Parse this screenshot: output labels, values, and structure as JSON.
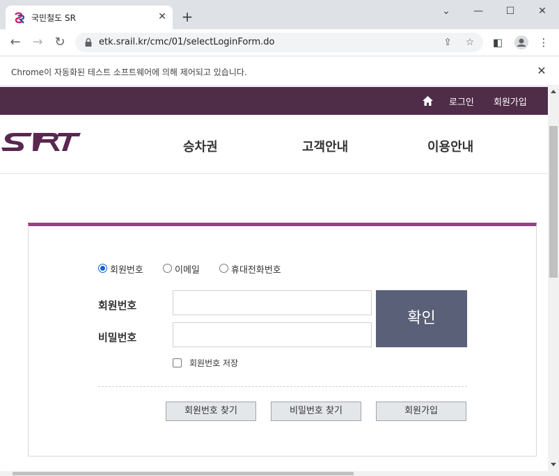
{
  "browser": {
    "tab_title": "국민철도 SR",
    "url": "etk.srail.kr/cmc/01/selectLoginForm.do",
    "infobar_text": "Chrome이 자동화된 테스트 소프트웨어에 의해 제어되고 있습니다.",
    "icons": [
      "back-arrow-icon",
      "forward-arrow-icon",
      "reload-icon",
      "lock-icon",
      "share-icon",
      "star-icon",
      "side-panel-icon",
      "profile-icon",
      "menu-icon"
    ]
  },
  "site": {
    "colors": {
      "topbar": "#4f2c48",
      "accent": "#9b3e85",
      "confirm": "#5b6079"
    },
    "topbar": {
      "login": "로그인",
      "signup": "회원가입"
    },
    "nav": {
      "tickets": "승차권",
      "customer": "고객안내",
      "guide": "이용안내"
    }
  },
  "login": {
    "radios": {
      "member_no": "회원번호",
      "email": "이메일",
      "phone": "휴대전화번호",
      "selected": "회원번호"
    },
    "id_label": "회원번호",
    "pw_label": "비밀번호",
    "id_value": "",
    "pw_value": "",
    "confirm": "확인",
    "save_id": "회원번호 저장",
    "find_id": "회원번호 찾기",
    "find_pw": "비밀번호 찾기",
    "join": "회원가입"
  }
}
